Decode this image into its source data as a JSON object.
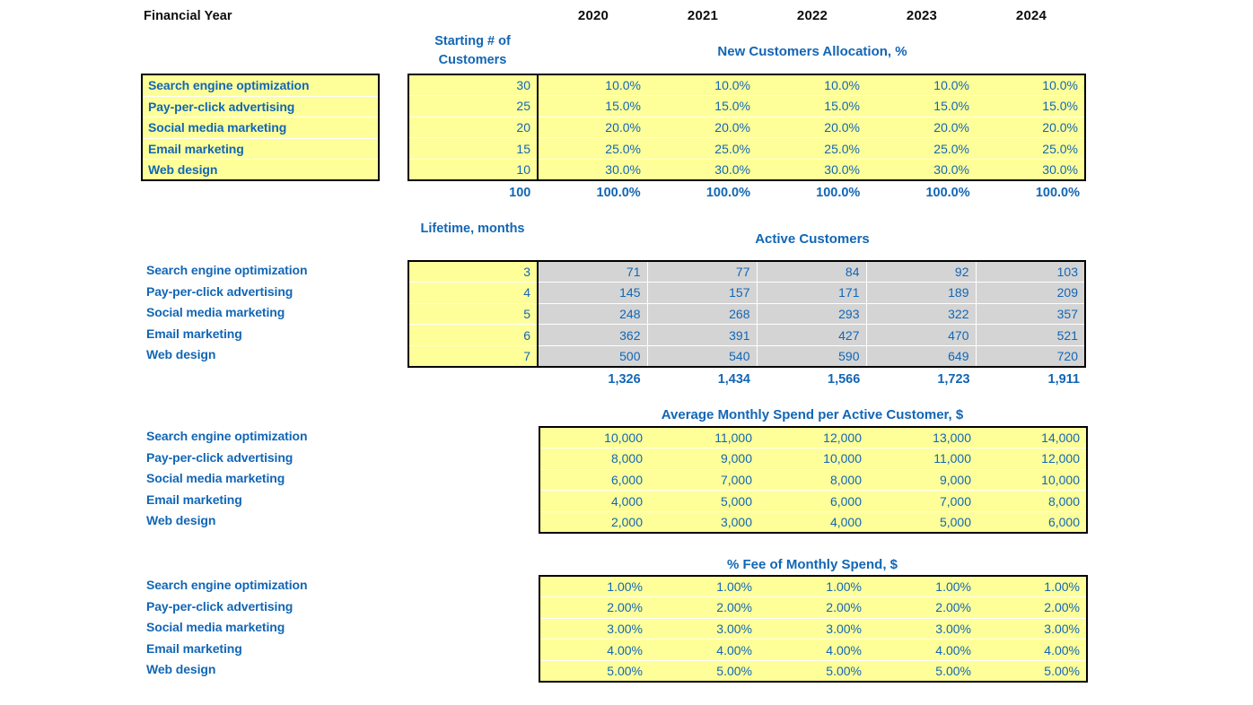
{
  "header": {
    "row_title": "Financial Year",
    "years": [
      "2020",
      "2021",
      "2022",
      "2023",
      "2024"
    ]
  },
  "channels": [
    "Search engine optimization",
    "Pay-per-click advertising",
    "Social media marketing",
    "Email marketing",
    "Web design"
  ],
  "colors": {
    "accent_blue": "#1266b5",
    "input_yellow": "#ffff99",
    "calc_gray": "#d4d4d4",
    "border_black": "#000000",
    "header_black": "#0d0d0d"
  },
  "blocks": [
    {
      "id": "new-customers-allocation",
      "side_column_title": "Starting # of Customers",
      "section_title": "New Customers Allocation, %",
      "side_values": [
        "30",
        "25",
        "20",
        "15",
        "10"
      ],
      "side_total": "100",
      "rows": [
        [
          "10.0%",
          "10.0%",
          "10.0%",
          "10.0%",
          "10.0%"
        ],
        [
          "15.0%",
          "15.0%",
          "15.0%",
          "15.0%",
          "15.0%"
        ],
        [
          "20.0%",
          "20.0%",
          "20.0%",
          "20.0%",
          "20.0%"
        ],
        [
          "25.0%",
          "25.0%",
          "25.0%",
          "25.0%",
          "25.0%"
        ],
        [
          "30.0%",
          "30.0%",
          "30.0%",
          "30.0%",
          "30.0%"
        ]
      ],
      "totals": [
        "100.0%",
        "100.0%",
        "100.0%",
        "100.0%",
        "100.0%"
      ]
    },
    {
      "id": "active-customers",
      "side_column_title": "Lifetime, months",
      "section_title": "Active Customers",
      "side_values": [
        "3",
        "4",
        "5",
        "6",
        "7"
      ],
      "rows": [
        [
          "71",
          "77",
          "84",
          "92",
          "103"
        ],
        [
          "145",
          "157",
          "171",
          "189",
          "209"
        ],
        [
          "248",
          "268",
          "293",
          "322",
          "357"
        ],
        [
          "362",
          "391",
          "427",
          "470",
          "521"
        ],
        [
          "500",
          "540",
          "590",
          "649",
          "720"
        ]
      ],
      "totals": [
        "1,326",
        "1,434",
        "1,566",
        "1,723",
        "1,911"
      ]
    },
    {
      "id": "average-monthly-spend",
      "section_title": "Average Monthly Spend per Active Customer, $",
      "rows": [
        [
          "10,000",
          "11,000",
          "12,000",
          "13,000",
          "14,000"
        ],
        [
          "8,000",
          "9,000",
          "10,000",
          "11,000",
          "12,000"
        ],
        [
          "6,000",
          "7,000",
          "8,000",
          "9,000",
          "10,000"
        ],
        [
          "4,000",
          "5,000",
          "6,000",
          "7,000",
          "8,000"
        ],
        [
          "2,000",
          "3,000",
          "4,000",
          "5,000",
          "6,000"
        ]
      ]
    },
    {
      "id": "percent-fee-of-monthly-spend",
      "section_title": "% Fee of Monthly Spend, $",
      "rows": [
        [
          "1.00%",
          "1.00%",
          "1.00%",
          "1.00%",
          "1.00%"
        ],
        [
          "2.00%",
          "2.00%",
          "2.00%",
          "2.00%",
          "2.00%"
        ],
        [
          "3.00%",
          "3.00%",
          "3.00%",
          "3.00%",
          "3.00%"
        ],
        [
          "4.00%",
          "4.00%",
          "4.00%",
          "4.00%",
          "4.00%"
        ],
        [
          "5.00%",
          "5.00%",
          "5.00%",
          "5.00%",
          "5.00%"
        ]
      ]
    }
  ]
}
